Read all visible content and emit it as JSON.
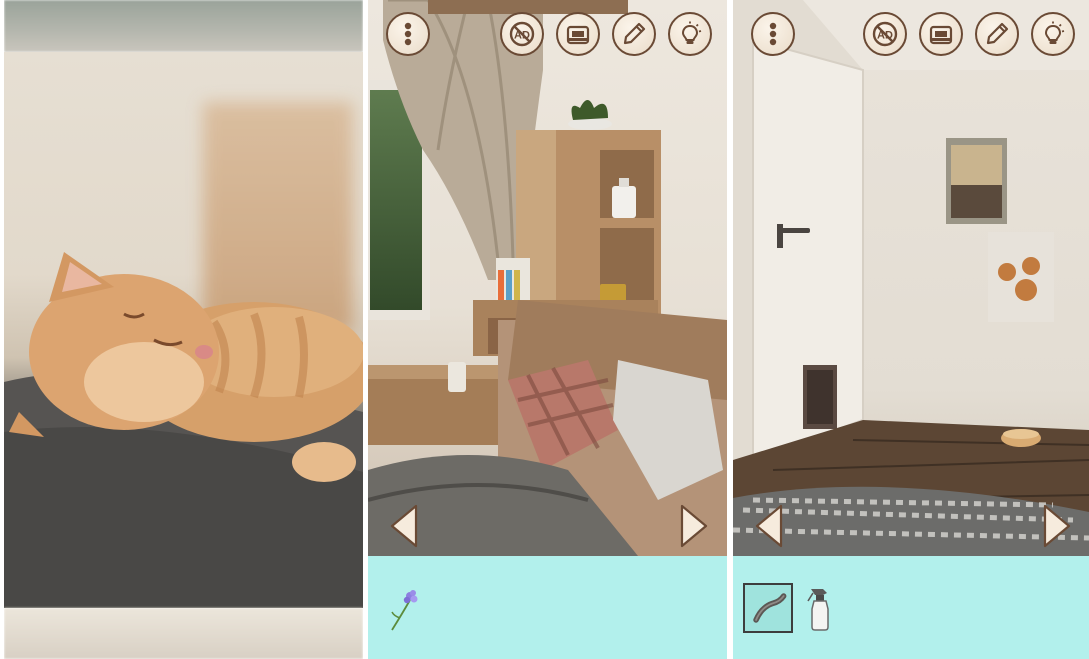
{
  "screens": [
    {
      "id": "cat-closeup",
      "subject": "sleeping-cat-photo"
    },
    {
      "id": "room-corner",
      "subject": "window-shelf-cushions"
    },
    {
      "id": "room-door",
      "subject": "door-pictures-rug"
    }
  ],
  "toolbar": {
    "menu_icon": "three-dots-icon",
    "ad_icon": "no-ad-icon",
    "camera_icon": "camera-icon",
    "pencil_icon": "pencil-icon",
    "hint_icon": "lightbulb-icon"
  },
  "inventory": {
    "room_corner_items": [
      {
        "name": "flower",
        "icon": "flower-icon",
        "selected": false
      }
    ],
    "room_door_items": [
      {
        "name": "bent-pipe",
        "icon": "bent-pipe-icon",
        "selected": true
      },
      {
        "name": "spray-bottle",
        "icon": "spray-bottle-icon",
        "selected": false
      }
    ]
  },
  "colors": {
    "inventory_bg": "#b2f0ec",
    "button_border": "#6a4a35",
    "button_fill": "#f3e9dc",
    "arrow_fill": "#f6ebdd",
    "arrow_stroke": "#6a4a35"
  }
}
